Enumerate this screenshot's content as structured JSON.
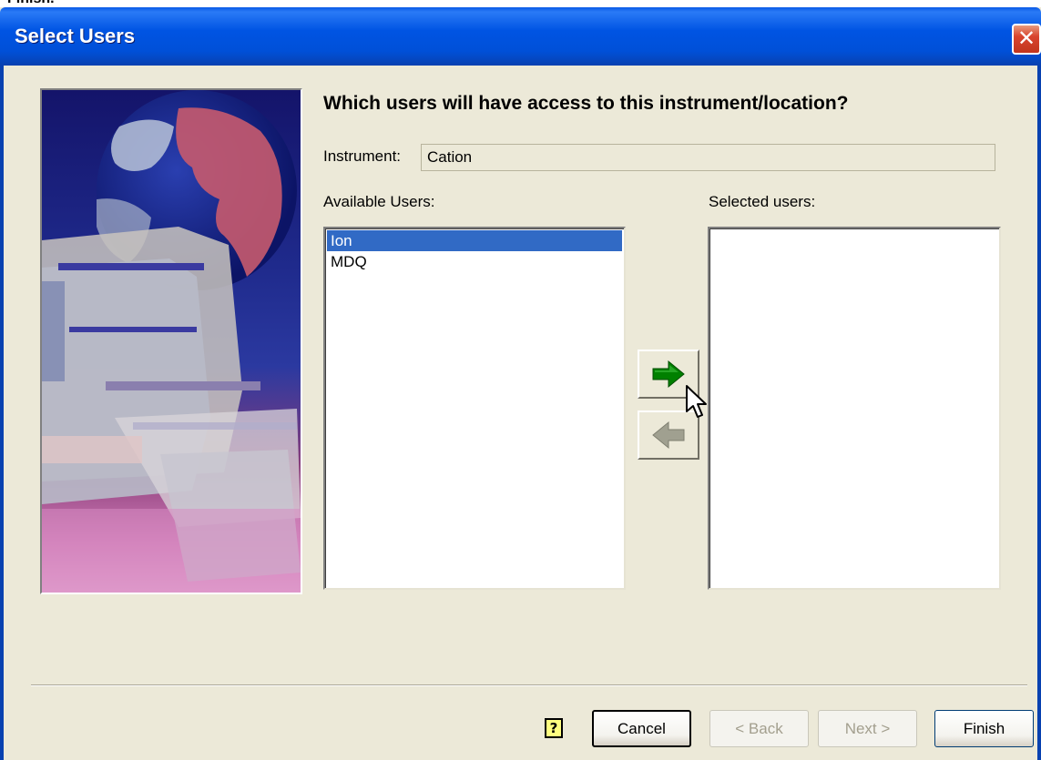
{
  "top_sliver_text": "Finish.",
  "window": {
    "title": "Select Users",
    "close_label": "✕"
  },
  "heading": "Which users will have access to this instrument/location?",
  "instrument": {
    "label": "Instrument:",
    "value": "Cation"
  },
  "available_users": {
    "label": "Available Users:",
    "items": [
      "Ion",
      "MDQ"
    ],
    "selected_item": "Ion"
  },
  "selected_users": {
    "label": "Selected users:",
    "items": []
  },
  "buttons": {
    "help_glyph": "?",
    "cancel": "Cancel",
    "back": "< Back",
    "next": "Next >",
    "finish": "Finish"
  },
  "icons": {
    "add": "arrow-right-icon",
    "remove": "arrow-left-icon",
    "help": "help-icon",
    "close": "close-icon"
  },
  "colors": {
    "titlebar": "#0054e3",
    "selection": "#316ac5",
    "add_arrow": "#008000",
    "remove_arrow_disabled": "#a0a090",
    "dialog_bg": "#ece9d8"
  }
}
